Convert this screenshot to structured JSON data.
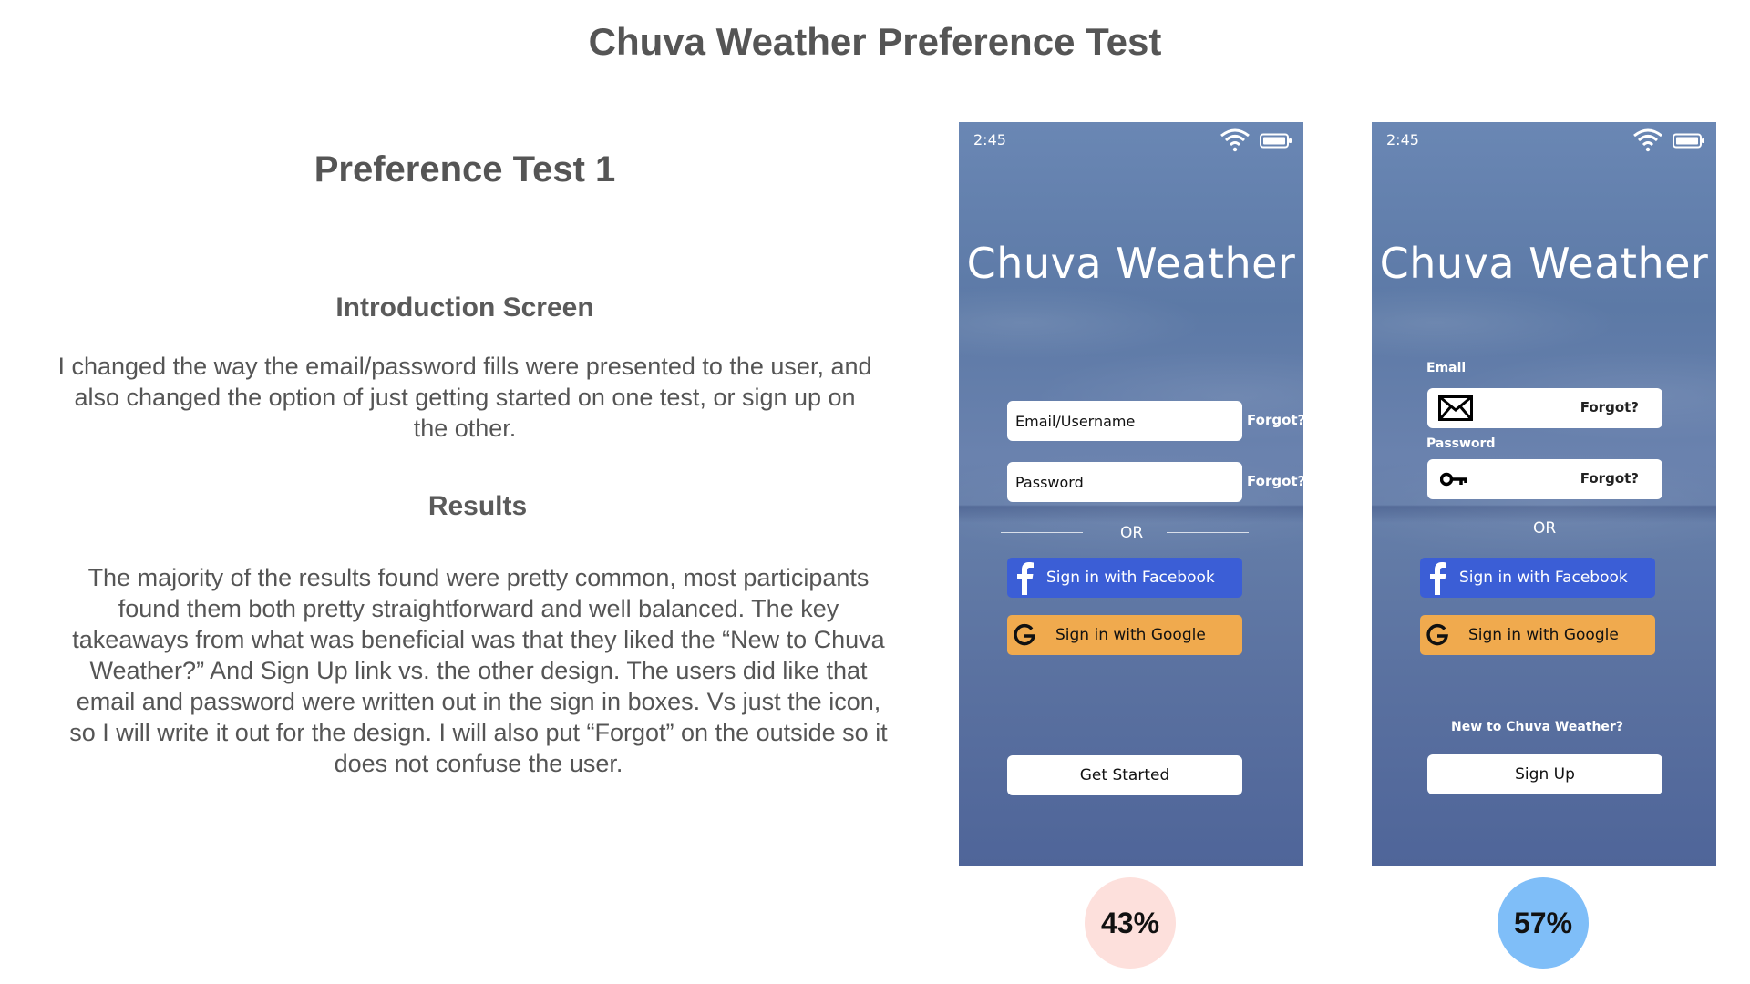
{
  "page": {
    "title": "Chuva Weather Preference Test"
  },
  "left": {
    "test_title": "Preference Test 1",
    "intro_heading": "Introduction Screen",
    "intro_text": "I changed the way the email/password fills were presented to the user, and also changed the option of just getting started on one test, or sign up on the other.",
    "results_heading": "Results",
    "results_text": "The majority of the results found were pretty common, most participants found them both pretty straightforward and well balanced. The key takeaways from what was beneficial was that they liked the “New to Chuva Weather?” And Sign Up link vs. the other design. The users did like that email and password were written out in the sign in boxes. Vs just the icon, so I will write it out for the design. I will also put “Forgot” on the outside so it does not confuse the user."
  },
  "phone_a": {
    "time": "2:45",
    "app_title": "Chuva Weather",
    "email_field": "Email/Username",
    "email_forgot": "Forgot?",
    "password_field": "Password",
    "password_forgot": "Forgot?",
    "or_text": "OR",
    "facebook_label": "Sign in with Facebook",
    "google_label": "Sign in with Google",
    "cta_label": "Get Started",
    "percent": "43%",
    "badge_color": "#fde0dc"
  },
  "phone_b": {
    "time": "2:45",
    "app_title": "Chuva Weather",
    "email_label": "Email",
    "email_forgot": "Forgot?",
    "password_label": "Password",
    "password_forgot": "Forgot?",
    "or_text": "OR",
    "facebook_label": "Sign in with Facebook",
    "google_label": "Sign in with Google",
    "new_to_text": "New to Chuva Weather?",
    "cta_label": "Sign Up",
    "percent": "57%",
    "badge_color": "#7fbef8"
  },
  "colors": {
    "facebook_blue": "#3b5ed6",
    "google_orange": "#f0aa4e",
    "phone_background": "#5c77a5",
    "heading_gray": "#555555"
  },
  "icons": {
    "status": [
      "wifi-icon",
      "battery-icon"
    ],
    "fields": [
      "envelope-icon",
      "key-icon"
    ],
    "social": [
      "facebook-icon",
      "google-icon"
    ]
  }
}
